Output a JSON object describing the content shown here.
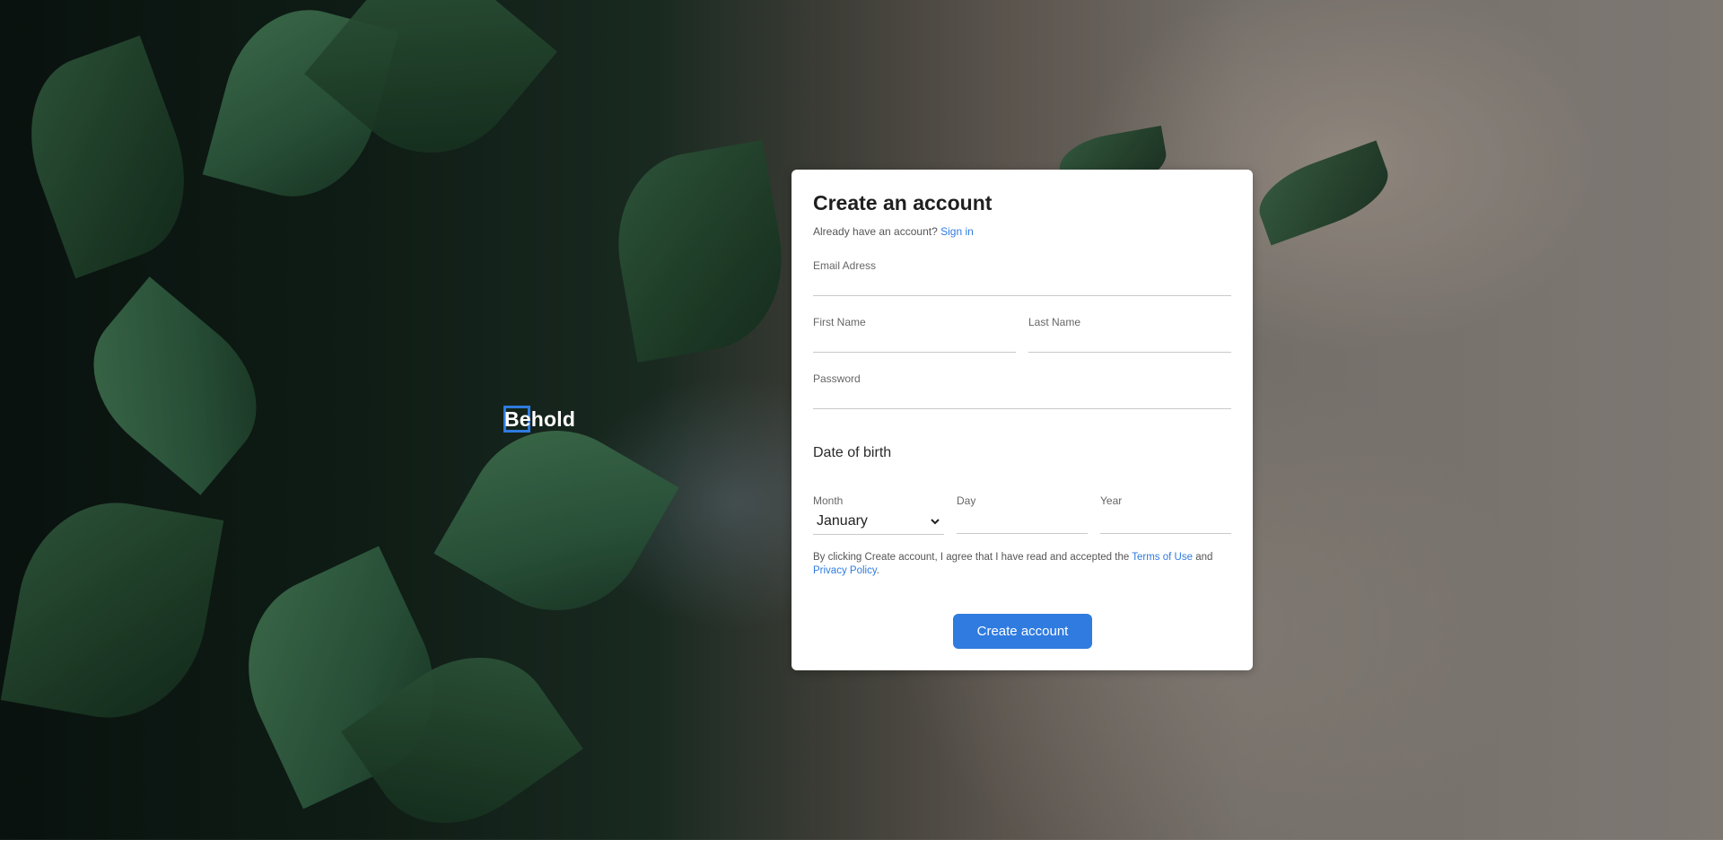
{
  "brand": {
    "name": "Behold"
  },
  "form": {
    "title": "Create an account",
    "signin_prompt": "Already have an account?",
    "signin_link": "Sign in",
    "email_label": "Email Adress",
    "email_value": "",
    "first_name_label": "First Name",
    "first_name_value": "",
    "last_name_label": "Last Name",
    "last_name_value": "",
    "password_label": "Password",
    "password_value": "",
    "dob_title": "Date of birth",
    "month_label": "Month",
    "month_value": "January",
    "day_label": "Day",
    "day_value": "",
    "year_label": "Year",
    "year_value": "",
    "terms_prefix": "By clicking Create account, I agree that I have read and accepted the",
    "terms_link": "Terms of Use",
    "terms_and": "and",
    "privacy_link": "Privacy Policy",
    "terms_suffix": ".",
    "submit_label": "Create account"
  },
  "colors": {
    "accent": "#2f7be0",
    "card": "#ffffff",
    "text": "#1f1f1f"
  },
  "icons": {
    "month_select": "chevron-down-icon"
  }
}
